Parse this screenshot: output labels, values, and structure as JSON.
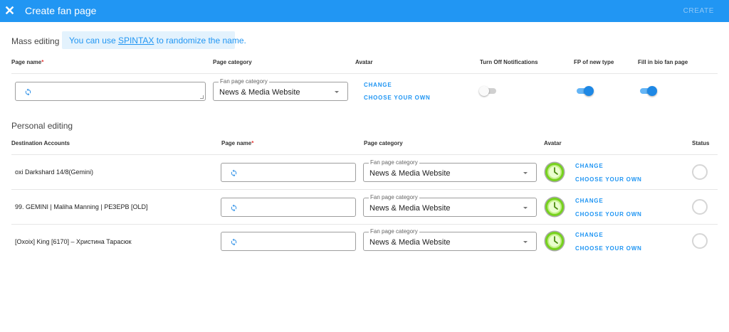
{
  "header": {
    "close_icon": "close-icon",
    "title": "Create fan page",
    "create_label": "CREATE"
  },
  "mass": {
    "label": "Mass editing",
    "hint_prefix": "You can use ",
    "hint_link": "SPINTAX",
    "hint_suffix": " to randomize the name.",
    "headers": {
      "page_name": "Page name",
      "required_mark": "*",
      "page_category": "Page category",
      "avatar": "Avatar",
      "turn_off_notifications": "Turn Off Notifications",
      "fp_new_type": "FP of new type",
      "fill_bio": "Fill in bio fan page"
    },
    "page_name_value": "",
    "category_legend": "Fan page category",
    "category_value": "News & Media Website",
    "change_label": "CHANGE",
    "choose_own_label": "CHOOSE YOUR OWN",
    "turn_off_notifications": false,
    "fp_new_type": true,
    "fill_bio": true
  },
  "personal": {
    "label": "Personal editing",
    "headers": {
      "destination": "Destination Accounts",
      "page_name": "Page name",
      "required_mark": "*",
      "page_category": "Page category",
      "avatar": "Avatar",
      "status": "Status"
    },
    "rows": [
      {
        "account": "oxi Darkshard 14/8(Gemini)",
        "page_name": "",
        "category_legend": "Fan page category",
        "category_value": "News & Media Website",
        "change_label": "CHANGE",
        "choose_own_label": "CHOOSE YOUR OWN"
      },
      {
        "account": "99. GEMINI | Maliha Manning | РЕЗЕРВ [OLD]",
        "page_name": "",
        "category_legend": "Fan page category",
        "category_value": "News & Media Website",
        "change_label": "CHANGE",
        "choose_own_label": "CHOOSE YOUR OWN"
      },
      {
        "account": "[Oxoix] King [6170] – Христина Тарасюк",
        "page_name": "",
        "category_legend": "Fan page category",
        "category_value": "News & Media Website",
        "change_label": "CHANGE",
        "choose_own_label": "CHOOSE YOUR OWN"
      }
    ]
  },
  "colors": {
    "header_bg": "#2196f3",
    "accent": "#2196f3",
    "hint_bg": "#e3f2fd",
    "required": "#e53935"
  },
  "icons": {
    "refresh": "refresh-icon",
    "avatar": "clock-icon",
    "caret": "chevron-down-icon"
  }
}
